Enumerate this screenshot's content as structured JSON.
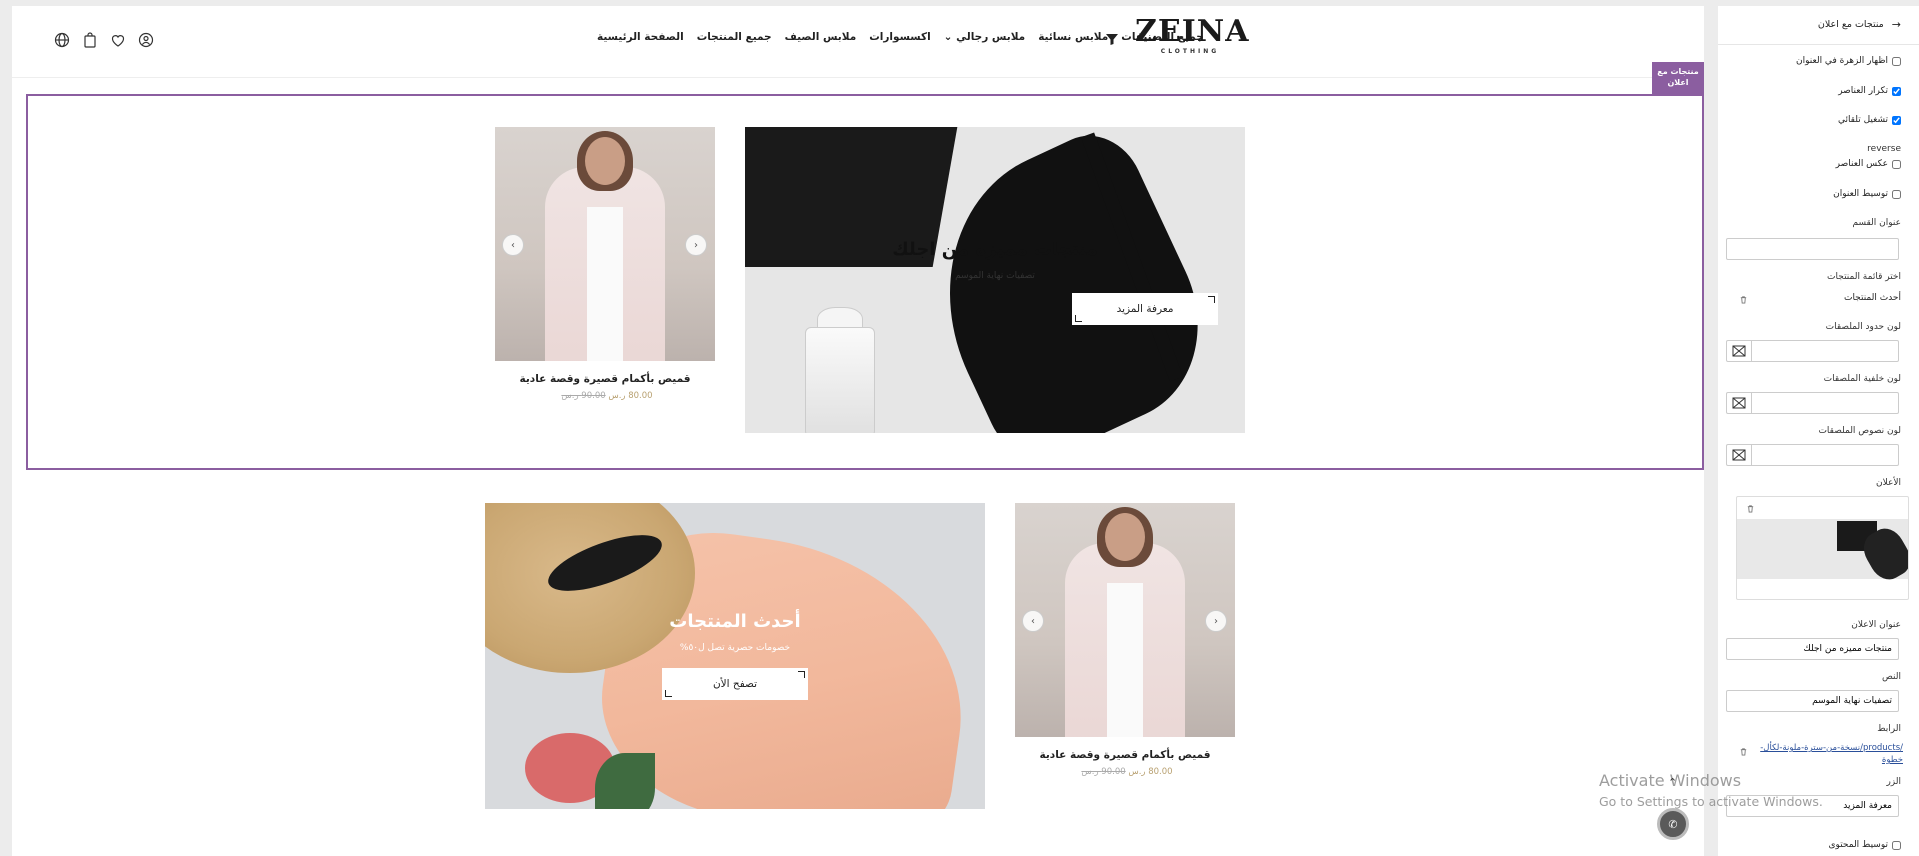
{
  "header": {
    "logo_main": "ZEINA",
    "logo_sub": "CLOTHING",
    "nav": [
      "الصفحة الرئيسية",
      "جميع المنتجات",
      "ملابس الصيف",
      "اكسسوارات",
      "ملابس رجالي",
      "ملابس نسائية",
      "جميع التصنيفات"
    ],
    "icons": [
      "globe-icon",
      "bag-icon",
      "heart-icon",
      "user-icon"
    ]
  },
  "section_tag": "منتجات مع اعلان",
  "section1": {
    "banner_title": "منتجات مميزه من اجلك",
    "banner_subtitle": "تصفيات نهاية الموسم",
    "banner_button": "معرفة المزيد",
    "product_name": "قميص بأكمام قصيرة وقصة عادية",
    "price_new": "80.00 ر.س",
    "price_old": "90.00 ر.س"
  },
  "section2": {
    "banner_title": "أحدث المنتجات",
    "banner_subtitle": "خصومات حصرية تصل ل٥٠%",
    "banner_button": "تصفح الأن",
    "product_name": "قميص بأكمام قصيرة وقصة عادية",
    "price_new": "80.00 ر.س",
    "price_old": "90.00 ر.س"
  },
  "sidebar": {
    "title": "منتجات مع اعلان",
    "checkboxes": [
      {
        "label": "اظهار الزهرة في العنوان",
        "checked": false
      },
      {
        "label": "تكرار العناصر",
        "checked": true
      },
      {
        "label": "تشغيل تلقائي",
        "checked": true
      }
    ],
    "reverse_heading": "reverse",
    "reverse_label": "عكس العناصر",
    "center_title_label": "توسيط العنوان",
    "section_title_label": "عنوان القسم",
    "section_title_value": "",
    "product_list_label": "اختر قائمة المنتجات",
    "product_list_value": "أحدث المنتجات",
    "border_color_label": "لون حدود الملصقات",
    "bg_color_label": "لون خلفية الملصقات",
    "text_color_label": "لون نصوص الملصقات",
    "ad_label": "الأعلان",
    "ad_title_label": "عنوان الاعلان",
    "ad_title_value": "منتجات مميزه من اجلك",
    "text_label": "النص",
    "text_value": "تصفيات نهاية الموسم",
    "link_label": "الرابط",
    "link_value": "/products/نسخة-من-سترة-ملونة-لكأل-خطوة",
    "button_label": "الزر",
    "button_value": "معرفة المزيد",
    "center_content_label": "توسيط المحتوى"
  },
  "watermark": {
    "line1": "Activate Windows",
    "line2": "Go to Settings to activate Windows."
  }
}
